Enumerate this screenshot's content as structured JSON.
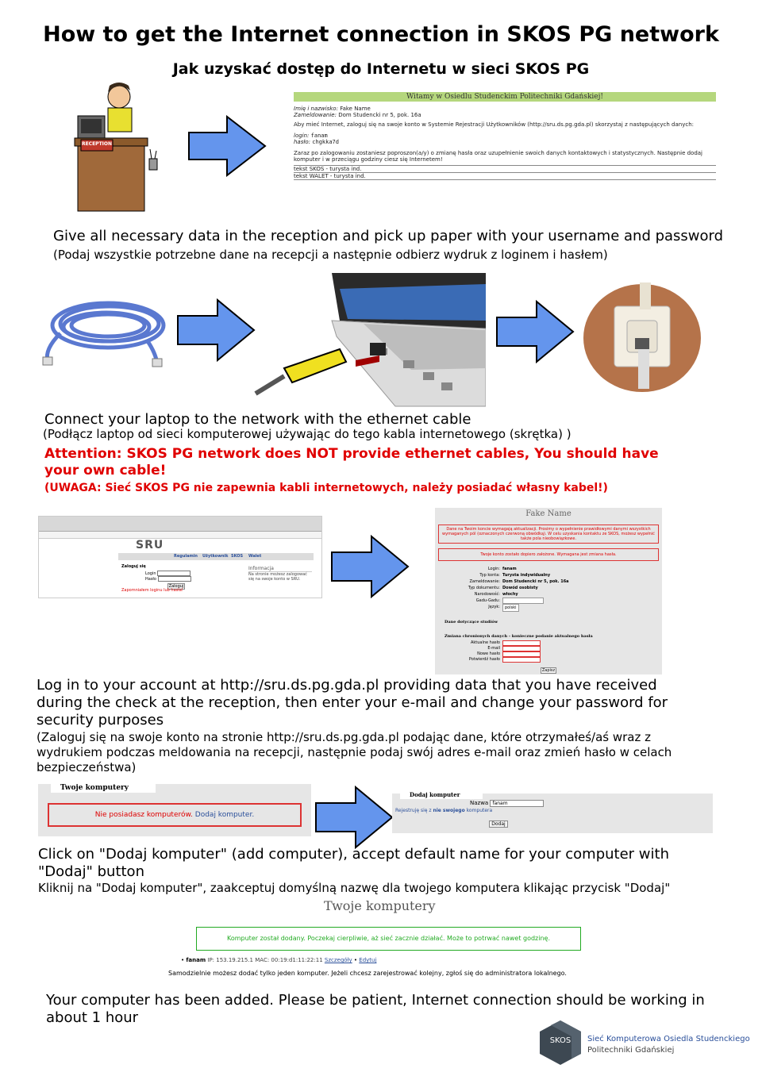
{
  "title": "How to get the Internet connection in SKOS PG network",
  "subtitle": "Jak uzyskać dostęp do Internetu w sieci SKOS PG",
  "step1": {
    "reception_sign": "RECEPTION",
    "paper": {
      "header": "Witamy w Osiedlu Studenckim Politechniki Gdańskiej!",
      "name_label": "Imię i nazwisko:",
      "name_value": "Fake Name",
      "address_label": "Zameldowanie:",
      "address_value": "Dom Studencki nr 5, pok. 16a",
      "info": "Aby mieć Internet, zaloguj się na swoje konto w Systemie Rejestracji Użytkowników (http://sru.ds.pg.gda.pl) skorzystaj z następujących danych:",
      "login_label": "login:",
      "login_value": "fanam",
      "password_label": "hasło:",
      "password_value": "chgkka7d",
      "after": "Zaraz po zalogowaniu zostaniesz poproszon(a/y) o zmianę hasła oraz uzupełnienie swoich danych kontaktowych i statystycznych. Następnie dodaj komputer i w przeciągu godziny ciesz się Internetem!",
      "line1": "tekst SKOS - turysta ind.",
      "line2": "tekst WALET - turysta ind."
    },
    "text_en": "Give all necessary data in the reception and pick up paper with your username and password",
    "text_pl": "(Podaj wszystkie potrzebne dane na recepcji a następnie odbierz wydruk z loginem i hasłem)"
  },
  "step2": {
    "text_en": "Connect your laptop to the network with the ethernet cable",
    "text_pl": "(Podłącz laptop od sieci komputerowej używając do tego kabla internetowego (skrętka) )",
    "warning_en": "Attention: SKOS PG network does NOT provide ethernet cables, You should have your own cable!",
    "warning_pl": "(UWAGA: Sieć SKOS PG nie zapewnia kabli internetowych, należy posiadać własny kabel!)"
  },
  "step3": {
    "sru_logo": "SRU",
    "nav": [
      "Regulamin",
      "Użytkownik",
      "SKOS",
      "Walet"
    ],
    "login_heading": "Zaloguj się",
    "login_label": "Login",
    "password_label": "Hasło",
    "login_button": "Zaloguj",
    "forgot_link": "Zapomniałem loginu lub hasła!",
    "info_heading": "Informacja",
    "info_text": "Na stronie możesz zalogować się na swoje konto w SRU.",
    "profile_name": "Fake Name",
    "alert1": "Dane na Twoim koncie wymagają aktualizacji. Prosimy o wypełnienie prawidłowymi danymi wszystkich wymaganych pól (oznaczonych czerwoną obwódką). W celu uzyskania kontaktu ze SKOS, możesz wypełnić także pola nieobowiązkowe.",
    "alert2": "Twoje konto zostało dopiero założone. Wymagana jest zmiana hasła.",
    "fields": [
      {
        "label": "Login:",
        "value": "fanam"
      },
      {
        "label": "Typ konta:",
        "value": "Turysta indywidualny"
      },
      {
        "label": "Zameldowanie:",
        "value": "Dom Studencki nr 5, pok. 16a"
      },
      {
        "label": "Typ dokumentu:",
        "value": "Dowód osobisty"
      },
      {
        "label": "Narodowość:",
        "value": "włochy"
      },
      {
        "label": "Gadu-Gadu:",
        "value": ""
      },
      {
        "label": "Język:",
        "value": "polski"
      }
    ],
    "studies_heading": "Dane dotyczące studiów",
    "password_heading": "Zmiana chronionych danych - konieczne podanie aktualnego hasła",
    "password_fields": [
      "Aktualne hasło",
      "E-mail",
      "Nowe hasło",
      "Potwierdź hasło"
    ],
    "save_button": "Zapisz",
    "text_en": "Log in to your account at http://sru.ds.pg.gda.pl providing data that you have received during the check at the reception, then enter your e-mail and change your password for security purposes",
    "text_pl": "(Zaloguj się na swoje konto na stronie http://sru.ds.pg.gda.pl podając dane, które otrzymałeś/aś wraz z wydrukiem podczas meldowania na recepcji, następnie podaj swój adres e-mail oraz zmień hasło w celach bezpieczeństwa)"
  },
  "step4": {
    "computers_tab": "Twoje komputery",
    "no_computers": "Nie posiadasz komputerów.",
    "add_link": "Dodaj komputer.",
    "add_tab": "Dodaj komputer",
    "name_label": "Nazwa",
    "name_value": "fanam",
    "register_prefix": "Rejestruję się z",
    "register_bold": "nie swojego",
    "register_suffix": "komputera",
    "add_button": "Dodaj",
    "text_en": "Click on \"Dodaj komputer\" (add computer), accept default name for your computer with \"Dodaj\" button",
    "text_pl": "Kliknij na \"Dodaj komputer\", zaakceptuj domyślną nazwę dla twojego komputera klikając przycisk \"Dodaj\""
  },
  "step5": {
    "heading": "Twoje komputery",
    "added_msg": "Komputer został dodany. Poczekaj cierpliwie, aż sieć zacznie działać. Może to potrwać nawet godzinę.",
    "computer_name": "fanam",
    "computer_ip": "IP: 153.19.215.1",
    "computer_mac": "MAC: 00:19:d1:11:22:11",
    "details_link": "Szczegóły",
    "edit_link": "Edytuj",
    "note": "Samodzielnie możesz dodać tylko jeden komputer. Jeżeli chcesz zarejestrować kolejny, zgłoś się do administratora lokalnego.",
    "text_en": "Your computer has been added. Please be patient, Internet connection should be working in about 1 hour"
  },
  "footer": {
    "logo_text": "SKOS",
    "org_line1": "Sieć Komputerowa Osiedla Studenckiego",
    "org_line2": "Politechniki Gdańskiej"
  },
  "colors": {
    "arrow_fill": "#6495ed",
    "warning": "#e00000",
    "paper_header": "#b5d77d",
    "link_blue": "#2a4f9a"
  }
}
